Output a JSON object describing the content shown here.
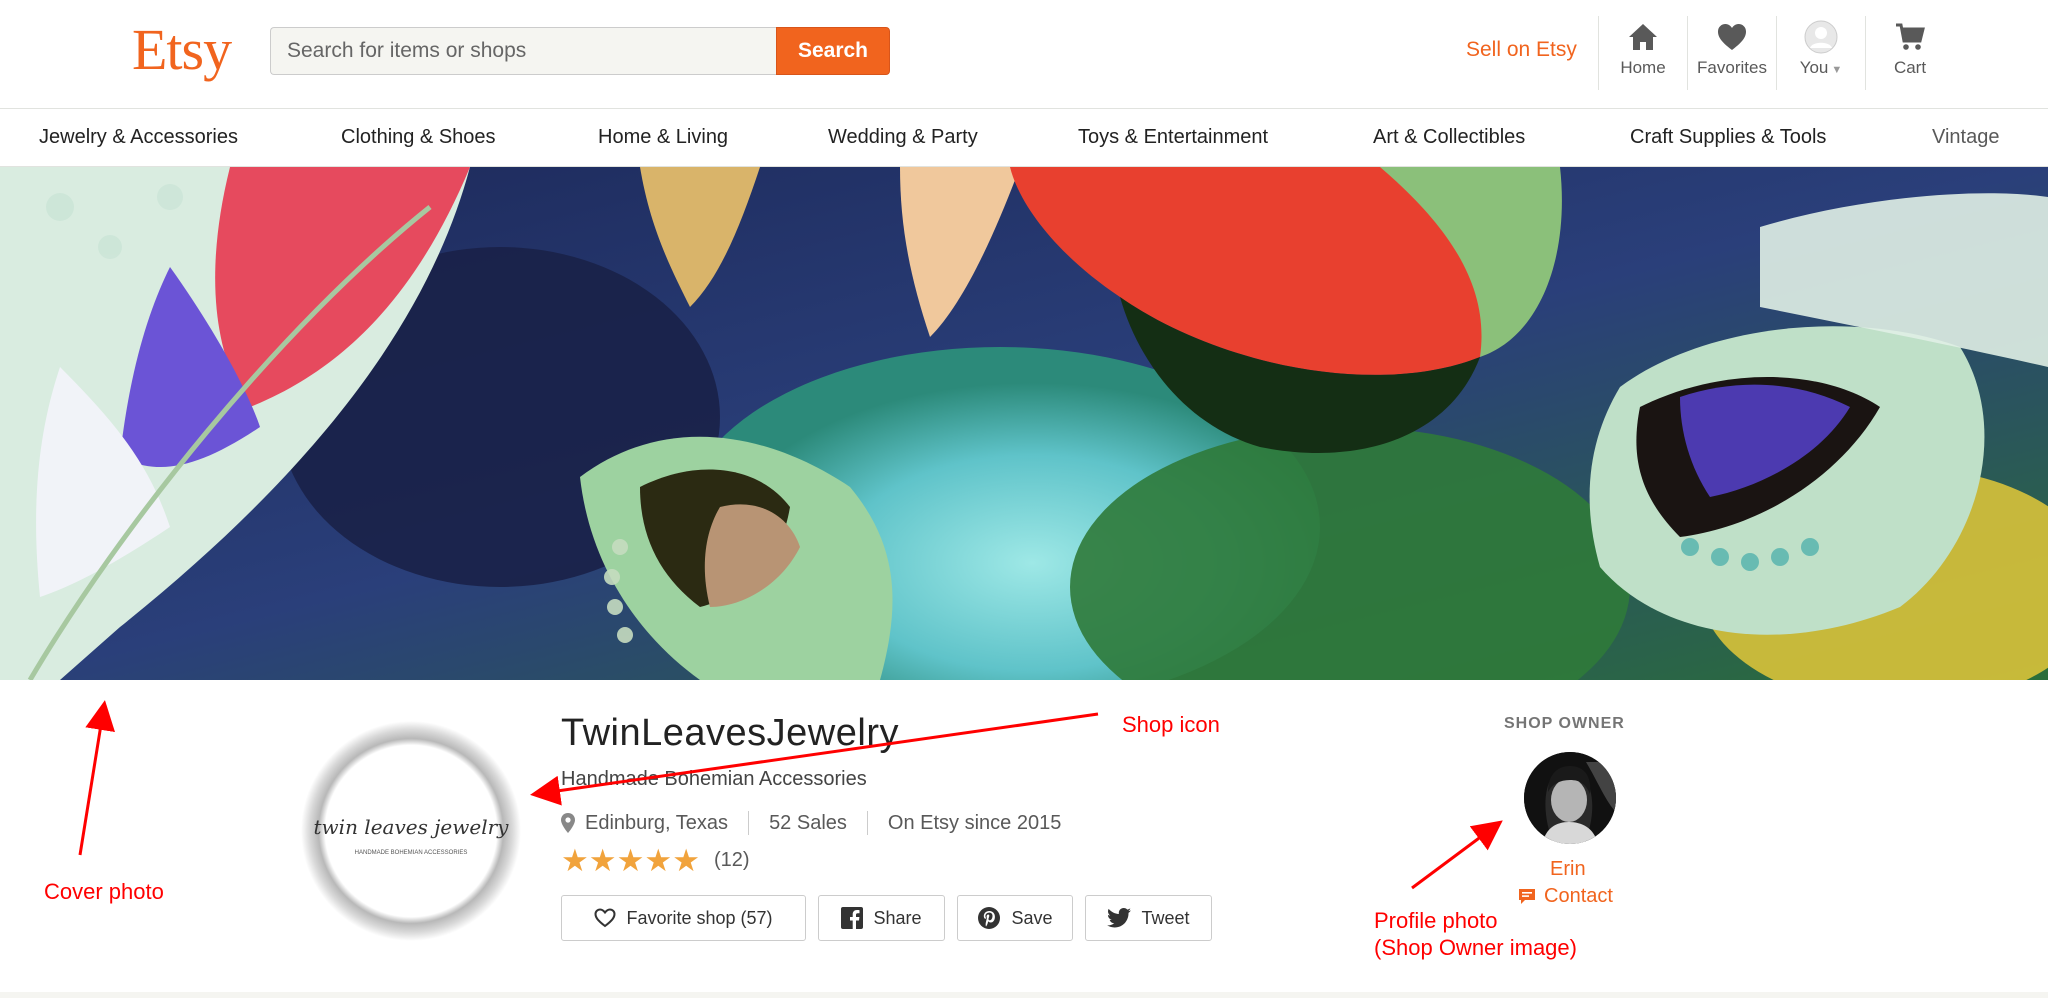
{
  "header": {
    "logo": "Etsy",
    "search_placeholder": "Search for items or shops",
    "search_button": "Search",
    "sell_link": "Sell on Etsy",
    "nav": [
      {
        "label": "Home",
        "icon": "home-icon"
      },
      {
        "label": "Favorites",
        "icon": "heart-icon"
      },
      {
        "label": "You",
        "icon": "user-avatar-icon"
      },
      {
        "label": "Cart",
        "icon": "cart-icon"
      }
    ]
  },
  "categories": [
    "Jewelry & Accessories",
    "Clothing & Shoes",
    "Home & Living",
    "Wedding & Party",
    "Toys & Entertainment",
    "Art & Collectibles",
    "Craft Supplies & Tools",
    "Vintage"
  ],
  "shop": {
    "icon_text": "twin leaves jewelry",
    "icon_subtext": "HANDMADE BOHEMIAN ACCESSORIES",
    "name": "TwinLeavesJewelry",
    "tagline": "Handmade Bohemian Accessories",
    "location": "Edinburg, Texas",
    "sales": "52 Sales",
    "since": "On Etsy since 2015",
    "rating_stars": 5,
    "review_count": "(12)",
    "buttons": {
      "favorite": "Favorite shop (57)",
      "share": "Share",
      "save": "Save",
      "tweet": "Tweet"
    }
  },
  "owner": {
    "heading": "SHOP OWNER",
    "name": "Erin",
    "contact": "Contact"
  },
  "annotations": {
    "cover": "Cover photo",
    "shop_icon": "Shop icon",
    "profile_line1": "Profile photo",
    "profile_line2": "(Shop Owner image)"
  },
  "colors": {
    "brand": "#f1641e",
    "star": "#f1a33c",
    "annotation": "#ff0000"
  }
}
